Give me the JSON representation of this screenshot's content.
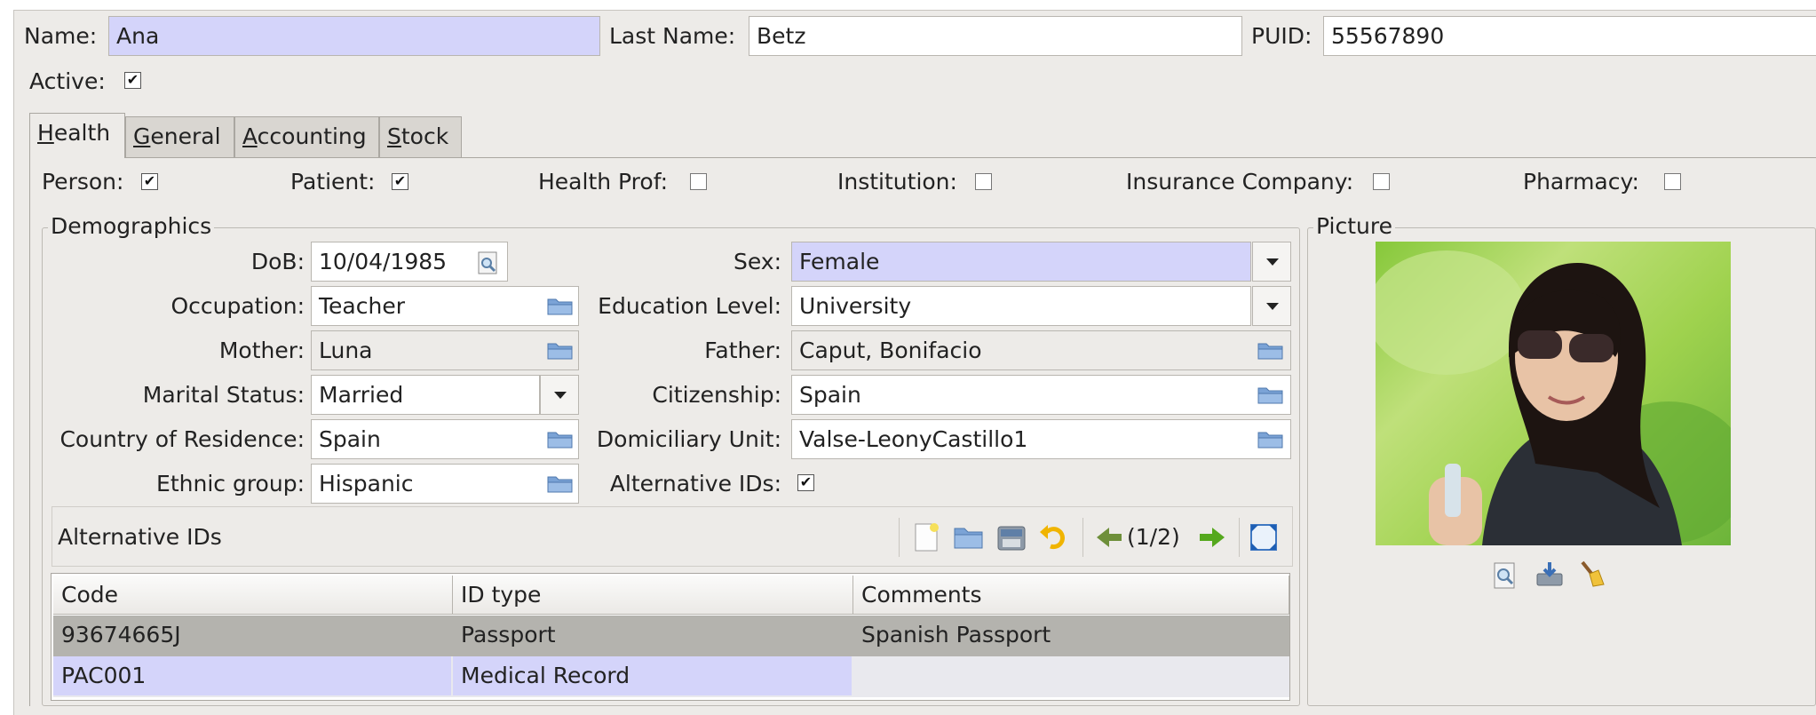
{
  "header": {
    "name_label": "Name:",
    "name_value": "Ana",
    "lastname_label": "Last Name:",
    "lastname_value": "Betz",
    "puid_label": "PUID:",
    "puid_value": "55567890",
    "active_label": "Active:",
    "active_checked": true
  },
  "tabs": [
    {
      "label": "Health",
      "mnemonic": "H",
      "rest": "ealth",
      "active": true
    },
    {
      "label": "General",
      "mnemonic": "G",
      "rest": "eneral",
      "active": false
    },
    {
      "label": "Accounting",
      "mnemonic": "A",
      "rest": "ccounting",
      "active": false
    },
    {
      "label": "Stock",
      "mnemonic": "S",
      "rest": "tock",
      "active": false
    }
  ],
  "roles": {
    "person_label": "Person:",
    "person_checked": true,
    "patient_label": "Patient:",
    "patient_checked": true,
    "health_prof_label": "Health Prof:",
    "health_prof_checked": false,
    "institution_label": "Institution:",
    "institution_checked": false,
    "insurance_label": "Insurance Company:",
    "insurance_checked": false,
    "pharmacy_label": "Pharmacy:",
    "pharmacy_checked": false,
    "check_mark": "✔"
  },
  "demographics": {
    "title": "Demographics",
    "dob_label": "DoB:",
    "dob_value": "10/04/1985",
    "sex_label": "Sex:",
    "sex_value": "Female",
    "occupation_label": "Occupation:",
    "occupation_value": "Teacher",
    "education_label": "Education Level:",
    "education_value": "University",
    "mother_label": "Mother:",
    "mother_value": "Luna",
    "father_label": "Father:",
    "father_value": "Caput, Bonifacio",
    "marital_label": "Marital Status:",
    "marital_value": "Married",
    "citizenship_label": "Citizenship:",
    "citizenship_value": "Spain",
    "residence_label": "Country of Residence:",
    "residence_value": "Spain",
    "domiciliary_label": "Domiciliary Unit:",
    "domiciliary_value": "Valse-LeonyCastillo1",
    "ethnic_label": "Ethnic group:",
    "ethnic_value": "Hispanic",
    "altids_label": "Alternative IDs:",
    "altids_checked": true
  },
  "altids": {
    "title": "Alternative IDs",
    "pager": "(1/2)",
    "columns": [
      "Code",
      "ID type",
      "Comments"
    ],
    "rows": [
      {
        "code": "93674665J",
        "id_type": "Passport",
        "comments": "Spanish Passport"
      },
      {
        "code": "PAC001",
        "id_type": "Medical Record",
        "comments": ""
      }
    ]
  },
  "picture": {
    "title": "Picture"
  },
  "colors": {
    "window_bg": "#edebe8",
    "required_field": "#d4d4fa",
    "selected_row": "#b4b3ae"
  },
  "icons": [
    "calendar-search-icon",
    "folder-open-icon",
    "dropdown-arrow-icon",
    "new-record-icon",
    "open-icon",
    "save-icon",
    "undo-icon",
    "previous-icon",
    "next-icon",
    "switch-view-icon",
    "zoom-icon",
    "save-image-icon",
    "clear-icon"
  ]
}
